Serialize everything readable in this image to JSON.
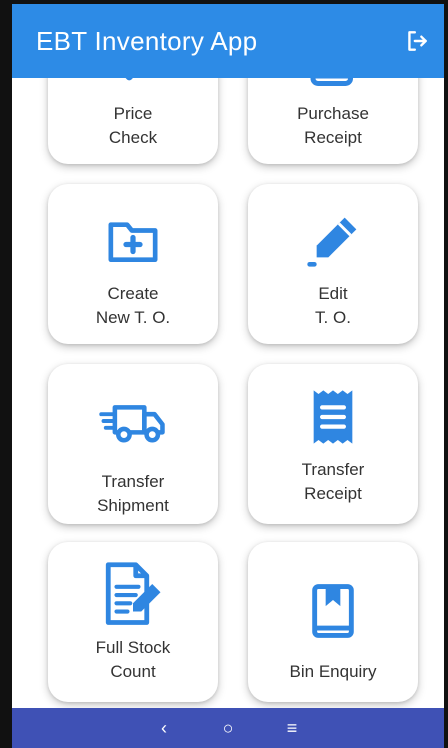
{
  "app": {
    "title": "EBT Inventory App"
  },
  "colors": {
    "accent": "#2d8be6",
    "navbar": "#3f51b5",
    "icon": "#2f86e1"
  },
  "tiles": [
    {
      "label": "Price\nCheck",
      "icon": "price-check-icon"
    },
    {
      "label": "Purchase\nReceipt",
      "icon": "receipt-icon"
    },
    {
      "label": "Create\nNew T. O.",
      "icon": "folder-plus-icon"
    },
    {
      "label": "Edit\nT. O.",
      "icon": "pencil-icon"
    },
    {
      "label": "Transfer\nShipment",
      "icon": "truck-icon"
    },
    {
      "label": "Transfer\nReceipt",
      "icon": "receipt-list-icon"
    },
    {
      "label": "Full Stock\nCount",
      "icon": "document-edit-icon"
    },
    {
      "label": "Bin Enquiry",
      "icon": "bookmark-book-icon"
    }
  ],
  "navbar": {
    "back": "‹",
    "home": "○",
    "menu": "≡"
  }
}
